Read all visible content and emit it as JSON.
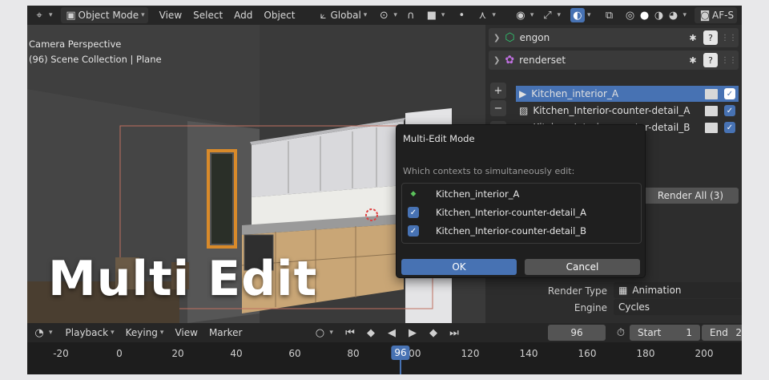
{
  "header": {
    "mode": "Object Mode",
    "menus": [
      "View",
      "Select",
      "Add",
      "Object"
    ],
    "transform_orientation": "Global",
    "right_label": "AF-S"
  },
  "viewport": {
    "info_line1": "Camera Perspective",
    "info_line2": "(96) Scene Collection | Plane",
    "overlay_title": "Multi Edit"
  },
  "panel": {
    "engon_label": "engon",
    "renderset_label": "renderset",
    "contexts": [
      {
        "name": "Kitchen_interior_A",
        "checked": true,
        "selected": true
      },
      {
        "name": "Kitchen_Interior-counter-detail_A",
        "checked": true,
        "selected": false
      },
      {
        "name": "Kitchen_Interior-counter-detail_B",
        "checked": true,
        "selected": false
      }
    ],
    "render_all": "Render All (3)",
    "render_type_label": "Render Type",
    "render_type_value": "Animation",
    "engine_label": "Engine",
    "engine_value": "Cycles"
  },
  "dialog": {
    "title": "Multi-Edit Mode",
    "subtitle": "Which contexts to simultaneously edit:",
    "items": [
      {
        "name": "Kitchen_interior_A",
        "state": "active"
      },
      {
        "name": "Kitchen_Interior-counter-detail_A",
        "state": "checked"
      },
      {
        "name": "Kitchen_Interior-counter-detail_B",
        "state": "checked"
      }
    ],
    "ok": "OK",
    "cancel": "Cancel"
  },
  "timeline": {
    "menus": [
      "Playback",
      "Keying",
      "View",
      "Marker"
    ],
    "current_frame": "96",
    "start_label": "Start",
    "start_value": "1",
    "end_label": "End",
    "end_value": "2",
    "ruler_ticks": [
      "-20",
      "0",
      "20",
      "40",
      "60",
      "80",
      "100",
      "120",
      "140",
      "160",
      "180",
      "200"
    ],
    "playhead": "96"
  },
  "colors": {
    "accent": "#4772b3",
    "background": "#2b2b2b"
  }
}
